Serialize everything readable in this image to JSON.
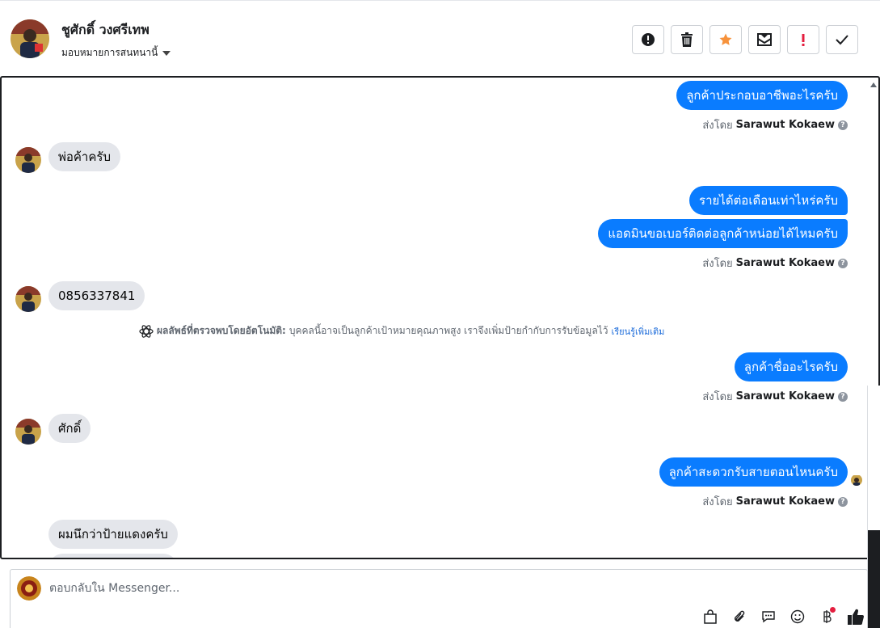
{
  "header": {
    "name": "ชูศักดิ์ วงศรีเทพ",
    "assign_label": "มอบหมายการสนทนานี้",
    "actions": [
      {
        "icon": "alert-circle-icon",
        "name": "mark-spam-button"
      },
      {
        "icon": "trash-icon",
        "name": "delete-button"
      },
      {
        "icon": "star-icon",
        "name": "star-button"
      },
      {
        "icon": "mark-unread-icon",
        "name": "mark-unread-button"
      },
      {
        "icon": "exclamation-icon",
        "name": "follow-up-button"
      },
      {
        "icon": "check-icon",
        "name": "mark-done-button"
      }
    ]
  },
  "messages": {
    "out1": "ลูกค้าประกอบอาชีพอะไรครับ",
    "in1": "พ่อค้าครับ",
    "out2": "รายได้ต่อเดือนเท่าไหร่ครับ",
    "out3": "แอดมินขอเบอร์ติดต่อลูกค้าหน่อยได้ไหมครับ",
    "in2": "0856337841",
    "out4": "ลูกค้าชื่ออะไรครับ",
    "in3": "ศักดิ์",
    "out5": "ลูกค้าสะดวกรับสายตอนไหนครับ",
    "in4": "ผมนึกว่าป้ายแดงครับ"
  },
  "sent_by": {
    "prefix": "ส่งโดย",
    "agent": "Sarawut Kokaew",
    "help": "?"
  },
  "auto_note": {
    "label": "ผลลัพธ์ที่ตรวจพบโดยอัตโนมัติ:",
    "text": "บุคคลนี้อาจเป็นลูกค้าเป้าหมายคุณภาพสูง เราจึงเพิ่มป้ายกำกับการรับข้อมูลไว้",
    "link": "เรียนรู้เพิ่มเติม"
  },
  "composer": {
    "placeholder": "ตอบกลับใน Messenger...",
    "tools": [
      "shop-bag-icon",
      "paperclip-icon",
      "saved-reply-icon",
      "emoji-icon",
      "baht-payment-icon",
      "thumbs-up-icon"
    ]
  },
  "colors": {
    "outgoing": "#0a7cff",
    "incoming": "#e4e6eb",
    "star": "#f7923b",
    "alert": "#e41e3f",
    "link": "#216fdb"
  }
}
